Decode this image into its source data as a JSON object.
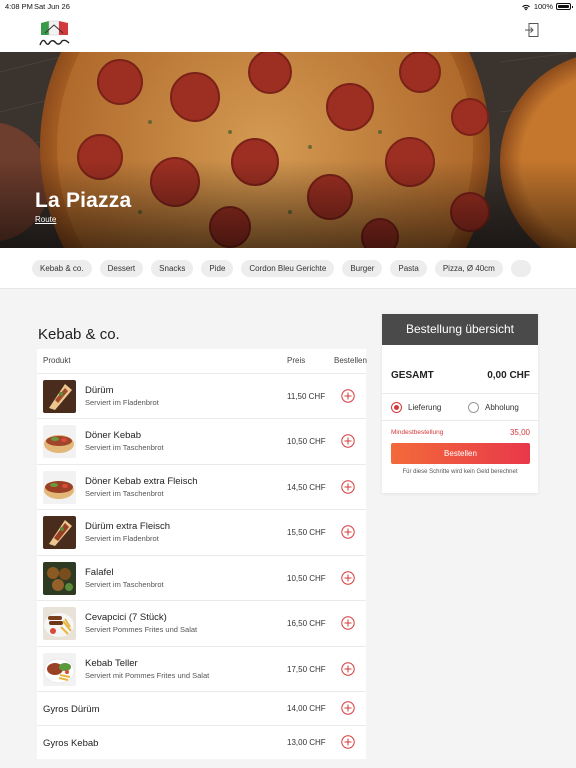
{
  "status_bar": {
    "time": "4:08 PM",
    "date": "Sat Jun 26",
    "battery": "100%"
  },
  "hero": {
    "title": "La Piazza",
    "route_label": "Route"
  },
  "categories": [
    "Kebab & co.",
    "Dessert",
    "Snacks",
    "Pide",
    "Cordon Bleu Gerichte",
    "Burger",
    "Pasta",
    "Pizza, Ø 40cm"
  ],
  "section": {
    "title": "Kebab & co."
  },
  "table": {
    "col_product": "Produkt",
    "col_price": "Preis",
    "col_order": "Bestellen"
  },
  "items": [
    {
      "name": "Dürüm",
      "desc": "Serviert im Fladenbrot",
      "price": "11,50 CHF"
    },
    {
      "name": "Döner Kebab",
      "desc": "Serviert im Taschenbrot",
      "price": "10,50 CHF"
    },
    {
      "name": "Döner Kebab extra Fleisch",
      "desc": "Serviert im Taschenbrot",
      "price": "14,50 CHF"
    },
    {
      "name": "Dürüm extra Fleisch",
      "desc": "Serviert im Fladenbrot",
      "price": "15,50 CHF"
    },
    {
      "name": "Falafel",
      "desc": "Serviert im Taschenbrot",
      "price": "10,50 CHF"
    },
    {
      "name": "Cevapcici (7 Stück)",
      "desc": "Serviert Pommes Frites und Salat",
      "price": "16,50 CHF"
    },
    {
      "name": "Kebab Teller",
      "desc": "Serviert mit Pommes Frites und Salat",
      "price": "17,50 CHF"
    },
    {
      "name": "Gyros Dürüm",
      "desc": "",
      "price": "14,00 CHF"
    },
    {
      "name": "Gyros Kebab",
      "desc": "",
      "price": "13,00 CHF"
    }
  ],
  "order": {
    "title": "Bestellung übersicht",
    "total_label": "GESAMT",
    "total_value": "0,00 CHF",
    "delivery_label": "Lieferung",
    "pickup_label": "Abholung",
    "min_label": "Mindestbestellung",
    "min_value": "35,00",
    "order_button": "Bestellen",
    "note": "Für diese Schritte wird kein Geld berechnet"
  },
  "colors": {
    "accent": "#d33a3a",
    "order_header": "#4a4a4a",
    "button_start": "#f26a3a",
    "button_end": "#e8384a"
  }
}
